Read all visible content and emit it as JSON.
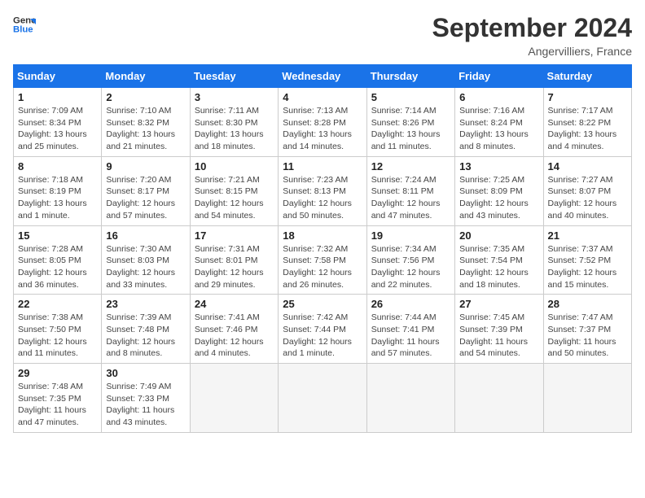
{
  "header": {
    "logo_general": "General",
    "logo_blue": "Blue",
    "title": "September 2024",
    "subtitle": "Angervilliers, France"
  },
  "columns": [
    "Sunday",
    "Monday",
    "Tuesday",
    "Wednesday",
    "Thursday",
    "Friday",
    "Saturday"
  ],
  "weeks": [
    [
      {
        "day": "1",
        "detail": "Sunrise: 7:09 AM\nSunset: 8:34 PM\nDaylight: 13 hours\nand 25 minutes."
      },
      {
        "day": "2",
        "detail": "Sunrise: 7:10 AM\nSunset: 8:32 PM\nDaylight: 13 hours\nand 21 minutes."
      },
      {
        "day": "3",
        "detail": "Sunrise: 7:11 AM\nSunset: 8:30 PM\nDaylight: 13 hours\nand 18 minutes."
      },
      {
        "day": "4",
        "detail": "Sunrise: 7:13 AM\nSunset: 8:28 PM\nDaylight: 13 hours\nand 14 minutes."
      },
      {
        "day": "5",
        "detail": "Sunrise: 7:14 AM\nSunset: 8:26 PM\nDaylight: 13 hours\nand 11 minutes."
      },
      {
        "day": "6",
        "detail": "Sunrise: 7:16 AM\nSunset: 8:24 PM\nDaylight: 13 hours\nand 8 minutes."
      },
      {
        "day": "7",
        "detail": "Sunrise: 7:17 AM\nSunset: 8:22 PM\nDaylight: 13 hours\nand 4 minutes."
      }
    ],
    [
      {
        "day": "8",
        "detail": "Sunrise: 7:18 AM\nSunset: 8:19 PM\nDaylight: 13 hours\nand 1 minute."
      },
      {
        "day": "9",
        "detail": "Sunrise: 7:20 AM\nSunset: 8:17 PM\nDaylight: 12 hours\nand 57 minutes."
      },
      {
        "day": "10",
        "detail": "Sunrise: 7:21 AM\nSunset: 8:15 PM\nDaylight: 12 hours\nand 54 minutes."
      },
      {
        "day": "11",
        "detail": "Sunrise: 7:23 AM\nSunset: 8:13 PM\nDaylight: 12 hours\nand 50 minutes."
      },
      {
        "day": "12",
        "detail": "Sunrise: 7:24 AM\nSunset: 8:11 PM\nDaylight: 12 hours\nand 47 minutes."
      },
      {
        "day": "13",
        "detail": "Sunrise: 7:25 AM\nSunset: 8:09 PM\nDaylight: 12 hours\nand 43 minutes."
      },
      {
        "day": "14",
        "detail": "Sunrise: 7:27 AM\nSunset: 8:07 PM\nDaylight: 12 hours\nand 40 minutes."
      }
    ],
    [
      {
        "day": "15",
        "detail": "Sunrise: 7:28 AM\nSunset: 8:05 PM\nDaylight: 12 hours\nand 36 minutes."
      },
      {
        "day": "16",
        "detail": "Sunrise: 7:30 AM\nSunset: 8:03 PM\nDaylight: 12 hours\nand 33 minutes."
      },
      {
        "day": "17",
        "detail": "Sunrise: 7:31 AM\nSunset: 8:01 PM\nDaylight: 12 hours\nand 29 minutes."
      },
      {
        "day": "18",
        "detail": "Sunrise: 7:32 AM\nSunset: 7:58 PM\nDaylight: 12 hours\nand 26 minutes."
      },
      {
        "day": "19",
        "detail": "Sunrise: 7:34 AM\nSunset: 7:56 PM\nDaylight: 12 hours\nand 22 minutes."
      },
      {
        "day": "20",
        "detail": "Sunrise: 7:35 AM\nSunset: 7:54 PM\nDaylight: 12 hours\nand 18 minutes."
      },
      {
        "day": "21",
        "detail": "Sunrise: 7:37 AM\nSunset: 7:52 PM\nDaylight: 12 hours\nand 15 minutes."
      }
    ],
    [
      {
        "day": "22",
        "detail": "Sunrise: 7:38 AM\nSunset: 7:50 PM\nDaylight: 12 hours\nand 11 minutes."
      },
      {
        "day": "23",
        "detail": "Sunrise: 7:39 AM\nSunset: 7:48 PM\nDaylight: 12 hours\nand 8 minutes."
      },
      {
        "day": "24",
        "detail": "Sunrise: 7:41 AM\nSunset: 7:46 PM\nDaylight: 12 hours\nand 4 minutes."
      },
      {
        "day": "25",
        "detail": "Sunrise: 7:42 AM\nSunset: 7:44 PM\nDaylight: 12 hours\nand 1 minute."
      },
      {
        "day": "26",
        "detail": "Sunrise: 7:44 AM\nSunset: 7:41 PM\nDaylight: 11 hours\nand 57 minutes."
      },
      {
        "day": "27",
        "detail": "Sunrise: 7:45 AM\nSunset: 7:39 PM\nDaylight: 11 hours\nand 54 minutes."
      },
      {
        "day": "28",
        "detail": "Sunrise: 7:47 AM\nSunset: 7:37 PM\nDaylight: 11 hours\nand 50 minutes."
      }
    ],
    [
      {
        "day": "29",
        "detail": "Sunrise: 7:48 AM\nSunset: 7:35 PM\nDaylight: 11 hours\nand 47 minutes."
      },
      {
        "day": "30",
        "detail": "Sunrise: 7:49 AM\nSunset: 7:33 PM\nDaylight: 11 hours\nand 43 minutes."
      },
      {
        "day": "",
        "detail": ""
      },
      {
        "day": "",
        "detail": ""
      },
      {
        "day": "",
        "detail": ""
      },
      {
        "day": "",
        "detail": ""
      },
      {
        "day": "",
        "detail": ""
      }
    ]
  ]
}
